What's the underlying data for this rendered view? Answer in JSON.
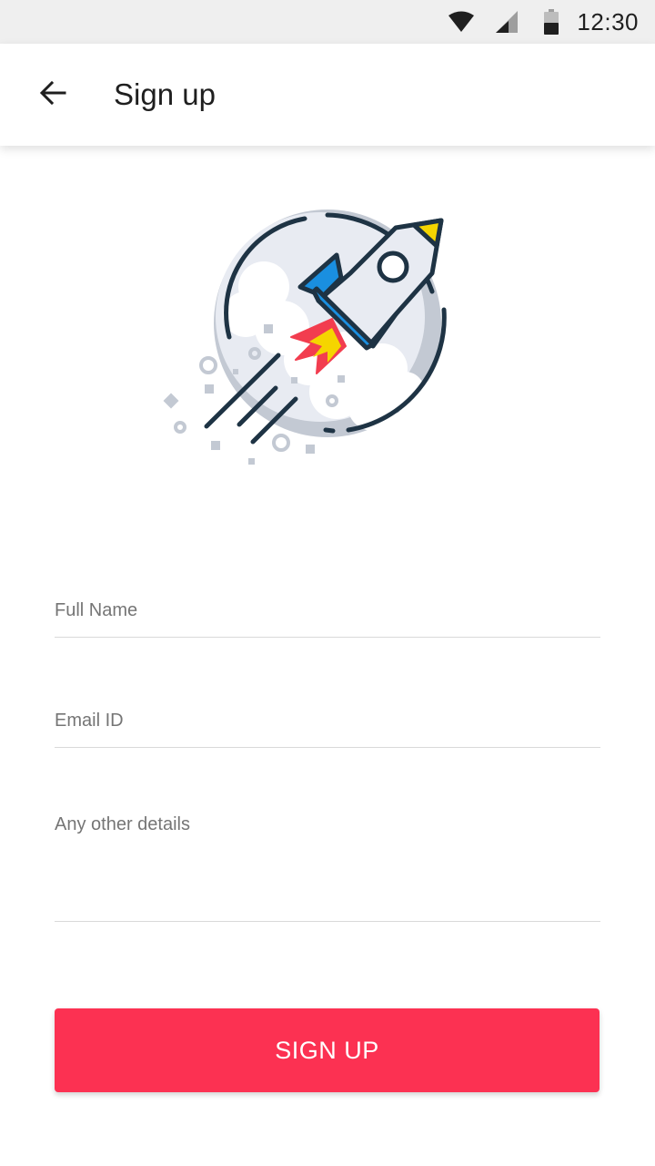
{
  "status_bar": {
    "time": "12:30",
    "icons": [
      "wifi-icon",
      "cell-signal-icon",
      "battery-icon"
    ]
  },
  "app_bar": {
    "back_icon": "arrow-back-icon",
    "title": "Sign up"
  },
  "illustration": {
    "name": "rocket-illustration",
    "colors": {
      "outline": "#1e3344",
      "moon": "#c3c9d3",
      "rocket_body": "#e8ebf2",
      "fins": "#1a8fe0",
      "nose": "#f5d500",
      "flame_red": "#f23d4f",
      "flame_yellow": "#f5d500"
    }
  },
  "form": {
    "full_name": {
      "placeholder": "Full Name",
      "value": ""
    },
    "email": {
      "placeholder": "Email ID",
      "value": ""
    },
    "details": {
      "placeholder": "Any other details",
      "value": ""
    }
  },
  "submit": {
    "label": "SIGN UP"
  },
  "colors": {
    "accent": "#fc3152",
    "status_bar_bg": "#efefef",
    "divider": "#d9d9d9"
  }
}
